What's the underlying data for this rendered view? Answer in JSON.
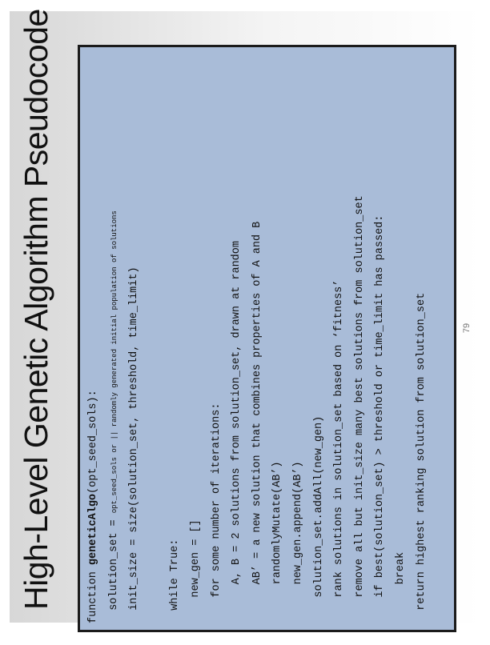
{
  "slide": {
    "title": "High-Level Genetic Algorithm Pseudocode",
    "page_number": "79"
  },
  "code": {
    "fn_keyword": "function ",
    "fn_name": "geneticAlgo",
    "fn_params": "(opt_seed_sols):",
    "l2a": "  solution_set = ",
    "l2b": "opt_seed_sols or || randomly generated initial population of solutions",
    "l3": "  init_size = size(solution_set, threshold, time_limit)",
    "l5": "  while True:",
    "l6": "    new_gen = []",
    "l7": "    for some number of iterations:",
    "l8": "      A, B = 2 solutions from solution_set, drawn at random",
    "l9": "      AB’ = a new solution that combines properties of A and B",
    "l10": "      randomlyMutate(AB’)",
    "l11": "      new_gen.append(AB’)",
    "l12": "    solution_set.addAll(new_gen)",
    "l13": "    rank solutions in solution_set based on ‘fitness’",
    "l14": "    remove all but init_size many best solutions from solution_set",
    "l15": "    if best(solution_set) > threshold or time_limit has passed:",
    "l16": "      break",
    "l17": "  return highest ranking solution from solution_set"
  }
}
